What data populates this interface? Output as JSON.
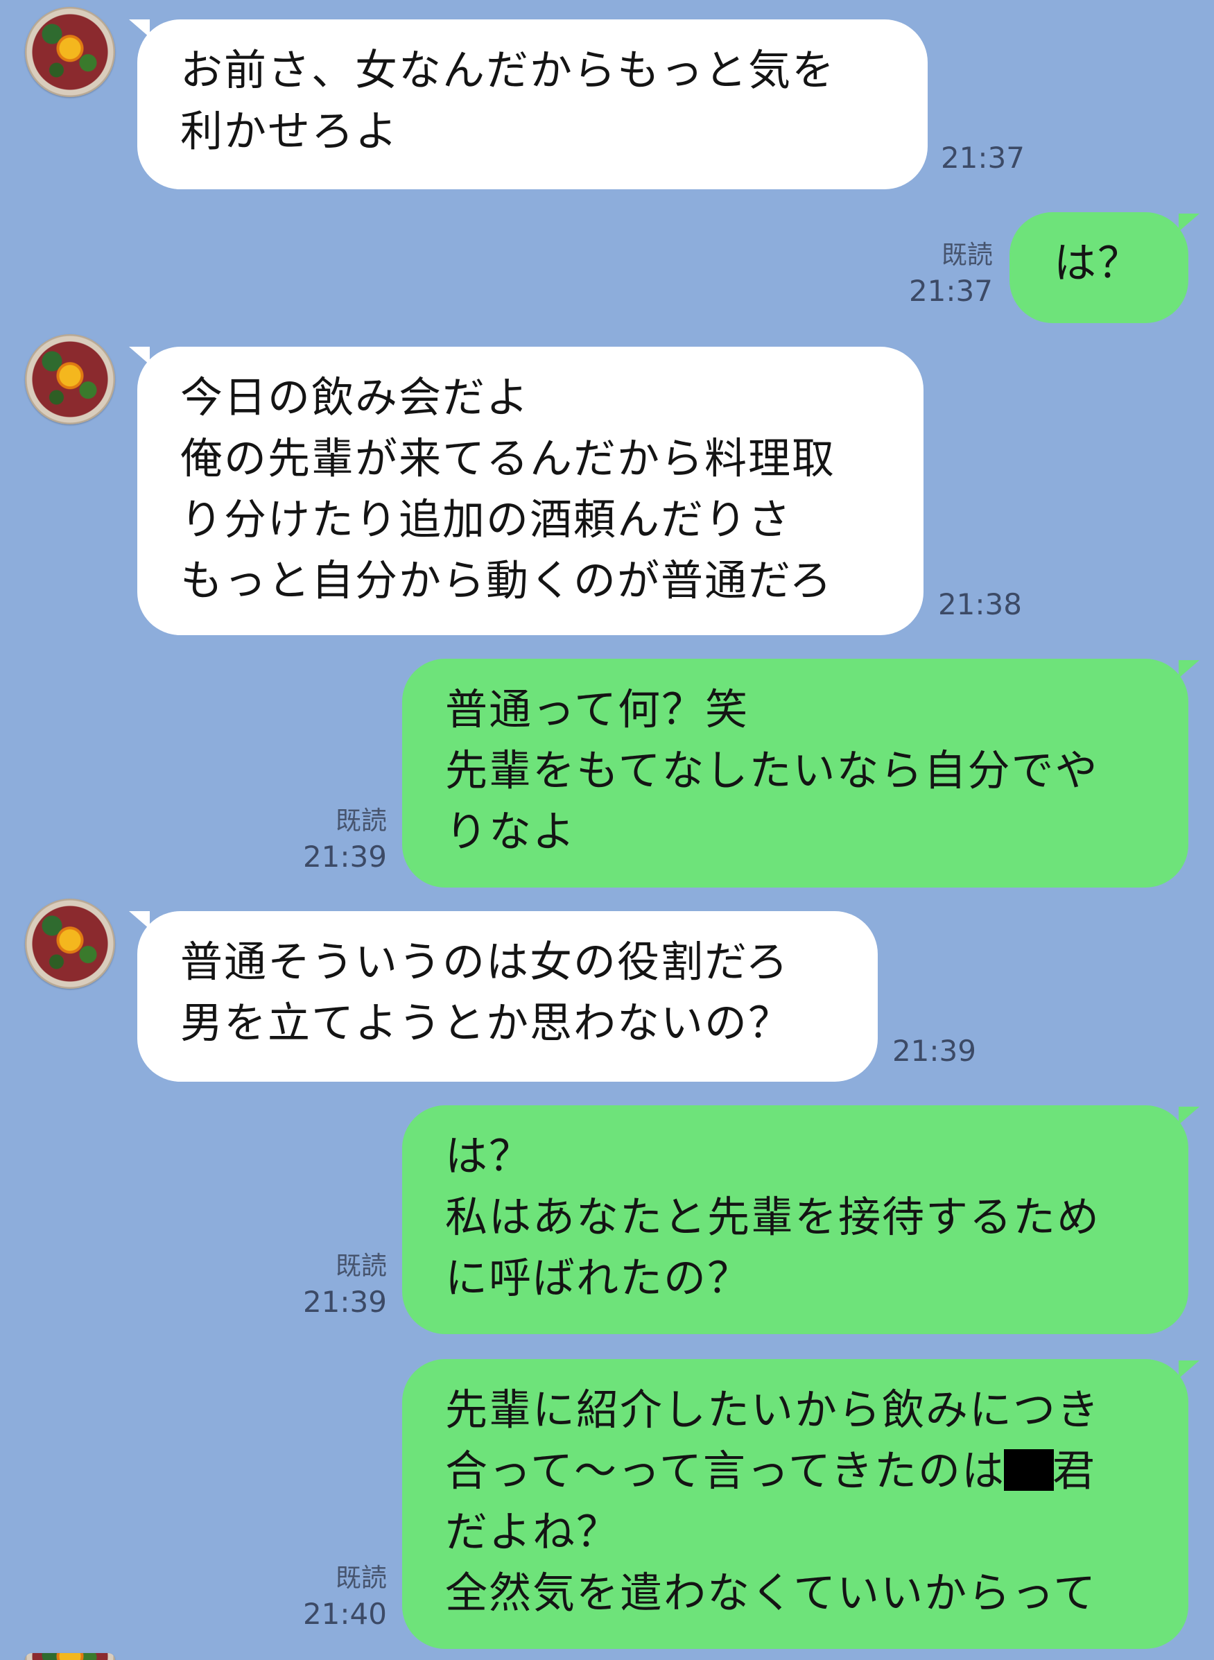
{
  "messages": [
    {
      "side": "left",
      "text": "お前さ、女なんだからもっと気を\n利かせろよ",
      "time": "21:37"
    },
    {
      "side": "right",
      "text": "は？",
      "read": "既読",
      "time": "21:37"
    },
    {
      "side": "left",
      "text": "今日の飲み会だよ\n俺の先輩が来てるんだから料理取\nり分けたり追加の酒頼んだりさ\nもっと自分から動くのが普通だろ",
      "time": "21:38"
    },
    {
      "side": "right",
      "text": "普通って何？笑\n先輩をもてなしたいなら自分でや\nりなよ",
      "read": "既読",
      "time": "21:39"
    },
    {
      "side": "left",
      "text": "普通そういうのは女の役割だろ\n男を立てようとか思わないの？",
      "time": "21:39"
    },
    {
      "side": "right",
      "text": "は？\n私はあなたと先輩を接待するため\nに呼ばれたの？",
      "read": "既読",
      "time": "21:39"
    },
    {
      "side": "right",
      "text_before_redaction": "先輩に紹介したいから飲みにつき\n合って〜って言ってきたのは",
      "text_after_redaction": "君\nだよね？\n全然気を遣わなくていいからって",
      "read": "既読",
      "time": "21:40"
    }
  ]
}
